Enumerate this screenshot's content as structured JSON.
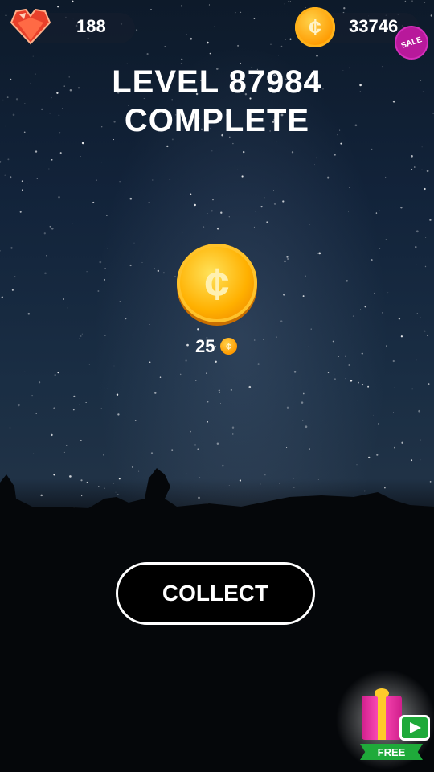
{
  "hud": {
    "gems": "188",
    "coins": "33746",
    "sale_badge": "SALE",
    "gem_icon": "heart-gem-icon",
    "coin_icon": "coin-icon",
    "coin_symbol": "¢"
  },
  "title": {
    "line1": "LEVEL 87984",
    "line2": "COMPLETE"
  },
  "reward": {
    "amount": "25",
    "coin_symbol": "¢"
  },
  "collect_button": {
    "label": "COLLECT"
  },
  "free_gift": {
    "label": "FREE",
    "gift_icon": "gift-box-icon",
    "video_icon": "play-video-icon"
  },
  "colors": {
    "coin": "#ffb000",
    "sale": "#b8199b",
    "free": "#1faa3a"
  }
}
